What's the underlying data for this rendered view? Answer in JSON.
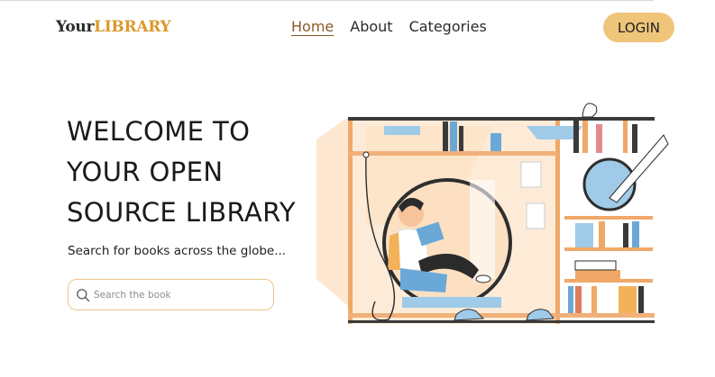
{
  "brand": {
    "part1": "Your",
    "part2": "LIBRARY"
  },
  "nav": {
    "items": [
      "Home",
      "About",
      "Categories"
    ],
    "active": "Home"
  },
  "login_label": "LOGIN",
  "hero": {
    "title_lines": [
      "WELCOME TO",
      "YOUR OPEN",
      "SOURCE LIBRARY"
    ],
    "subtitle": "Search for books across the globe..."
  },
  "search": {
    "placeholder": "Search the book",
    "value": ""
  },
  "colors": {
    "accent": "#efc57a",
    "brand_orange": "#d99a2b",
    "search_border": "#ecc58a",
    "active_link": "#8a5a26"
  },
  "icons": {
    "search": "search-icon",
    "illustration": "reading-person-bookshelf-illustration"
  }
}
